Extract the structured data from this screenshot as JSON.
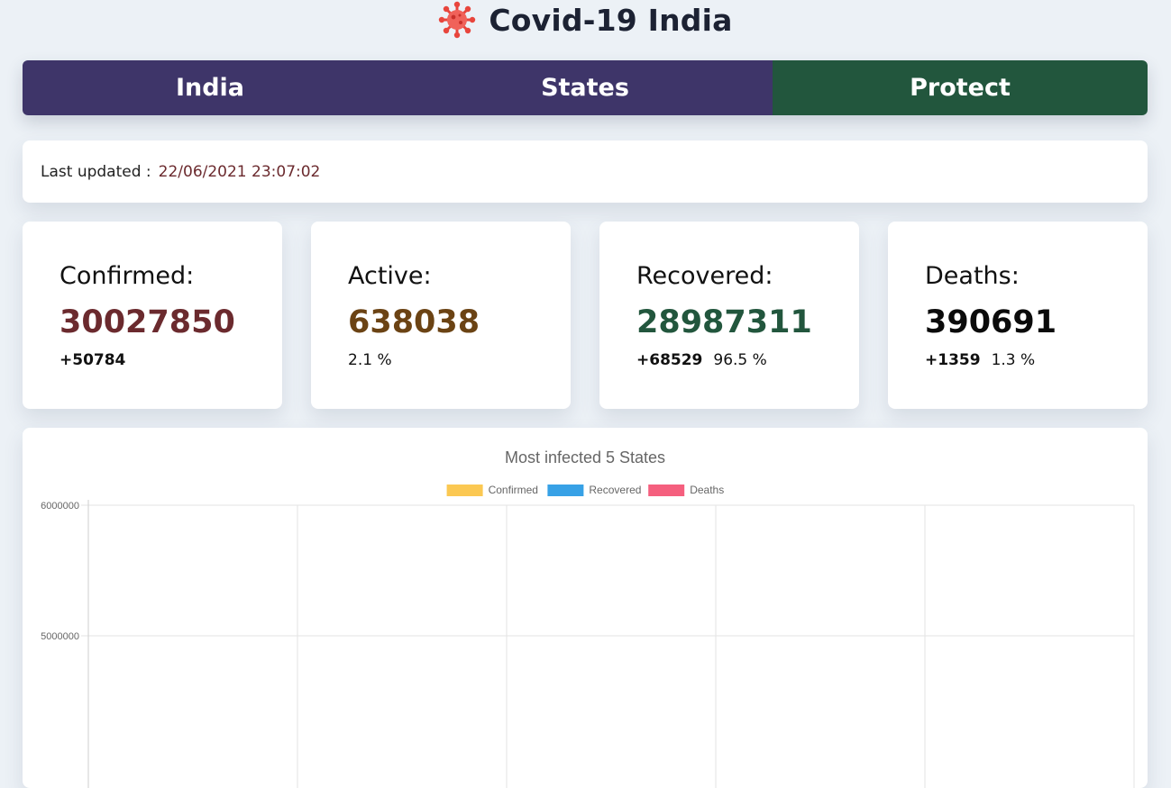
{
  "header": {
    "title": "Covid-19 India",
    "icon": "virus-icon"
  },
  "nav": {
    "tabs": [
      {
        "label": "India",
        "active": false
      },
      {
        "label": "States",
        "active": false
      },
      {
        "label": "Protect",
        "active": true
      }
    ]
  },
  "last_updated": {
    "label": "Last updated :",
    "value": "22/06/2021 23:07:02"
  },
  "stats": {
    "confirmed": {
      "label": "Confirmed:",
      "value": "30027850",
      "delta": "+50784",
      "color": "#6b2a2e"
    },
    "active": {
      "label": "Active:",
      "value": "638038",
      "percent": "2.1 %",
      "color": "#6b4314"
    },
    "recovered": {
      "label": "Recovered:",
      "value": "28987311",
      "delta": "+68529",
      "percent": "96.5 %",
      "color": "#22563d"
    },
    "deaths": {
      "label": "Deaths:",
      "value": "390691",
      "delta": "+1359",
      "percent": "1.3 %",
      "color": "#0b0b0b"
    }
  },
  "chart_data": {
    "type": "bar",
    "title": "Most infected 5 States",
    "categories": [],
    "series": [
      {
        "name": "Confirmed",
        "color": "#fbc852",
        "values": []
      },
      {
        "name": "Recovered",
        "color": "#37a1e6",
        "values": []
      },
      {
        "name": "Deaths",
        "color": "#f55f7e",
        "values": []
      }
    ],
    "yticks": [
      6000000,
      5000000
    ],
    "ylim_visible": [
      4300000,
      6000000
    ],
    "grid": true,
    "legend_position": "top"
  }
}
